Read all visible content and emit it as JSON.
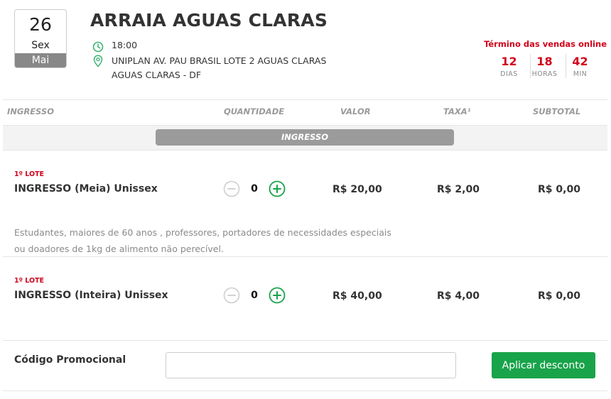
{
  "event": {
    "day": "26",
    "weekday": "Sex",
    "month": "Mai",
    "title": "ARRAIA AGUAS CLARAS",
    "time": "18:00",
    "address_line1": "UNIPLAN AV. PAU BRASIL LOTE 2 AGUAS CLARAS",
    "address_line2": "AGUAS CLARAS - DF"
  },
  "countdown": {
    "label": "Término das vendas online",
    "days": "12",
    "days_label": "DIAS",
    "hours": "18",
    "hours_label": "HORAS",
    "minutes": "42",
    "minutes_label": "MIN"
  },
  "table": {
    "col_ticket": "INGRESSO",
    "col_quantity": "QUANTIDADE",
    "col_value": "VALOR",
    "col_fee": "TAXA¹",
    "col_subtotal": "SUBTOTAL",
    "section": "INGRESSO"
  },
  "tickets": [
    {
      "lote": "1º LOTE",
      "name": "INGRESSO (Meia) Unissex",
      "quantity": "0",
      "price": "R$ 20,00",
      "fee": "R$ 2,00",
      "subtotal": "R$ 0,00",
      "description_line1": "Estudantes, maiores de 60 anos , professores, portadores de necessidades especiais",
      "description_line2": "ou doadores de 1kg de alimento não perecível."
    },
    {
      "lote": "1º LOTE",
      "name": "INGRESSO (Inteira) Unissex",
      "quantity": "0",
      "price": "R$ 40,00",
      "fee": "R$ 4,00",
      "subtotal": "R$ 0,00"
    }
  ],
  "promo": {
    "label": "Código Promocional",
    "input_value": "",
    "button": "Aplicar desconto"
  },
  "icons": {
    "time": "clock-icon",
    "location": "map-pin-icon",
    "minus": "minus-circle-icon",
    "plus": "plus-circle-icon"
  },
  "colors": {
    "accent_green": "#19a34a",
    "alert_red": "#d0021b",
    "muted_gray": "#9b9b9b"
  }
}
